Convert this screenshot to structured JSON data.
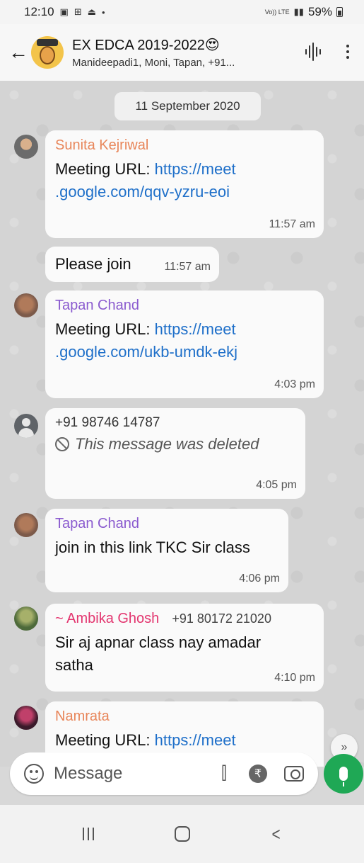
{
  "status_bar": {
    "time": "12:10",
    "network": "Vo)) LTE",
    "battery": "59%"
  },
  "header": {
    "title": "EX EDCA 2019-2022😍",
    "members": "Manideepadi1, Moni, Tapan, +91..."
  },
  "chat": {
    "date_chip": "11 September 2020",
    "messages": [
      {
        "sender": "Sunita Kejriwal",
        "prefix": "Meeting URL: ",
        "link_line1": "https://meet",
        "link_line2": ".google.com/qqv-yzru-eoi",
        "time": "11:57 am"
      },
      {
        "text": "Please join",
        "time": "11:57 am"
      },
      {
        "sender": "Tapan Chand",
        "prefix": "Meeting URL: ",
        "link_line1": "https://meet",
        "link_line2": ".google.com/ukb-umdk-ekj",
        "time": "4:03 pm"
      },
      {
        "sender": "+91 98746 14787",
        "text": "This message was deleted",
        "time": "4:05 pm"
      },
      {
        "sender": "Tapan Chand",
        "text": "join in this link TKC Sir class",
        "time": "4:06 pm"
      },
      {
        "sender": "~ Ambika Ghosh",
        "phone": "+91 80172 21020",
        "text_line1": "Sir aj apnar class nay amadar",
        "text_line2": "satha",
        "time": "4:10 pm"
      },
      {
        "sender": "Namrata",
        "prefix": "Meeting URL: ",
        "link_line1": "https://meet"
      }
    ]
  },
  "input": {
    "placeholder": "Message"
  },
  "icons": {
    "back": "arrow-left-icon",
    "voice": "voice-wave-icon",
    "menu": "more-vert-icon",
    "emoji": "emoji-icon",
    "attach": "paperclip-icon",
    "rupee": "rupee-icon",
    "camera": "camera-icon",
    "mic": "mic-icon",
    "scroll": "double-chevron-down-icon"
  },
  "colors": {
    "sender_orange": "#e8865a",
    "sender_purple": "#8a5acf",
    "sender_pink": "#e3356f",
    "link": "#1e6fc9",
    "mic_green": "#1fa855"
  }
}
